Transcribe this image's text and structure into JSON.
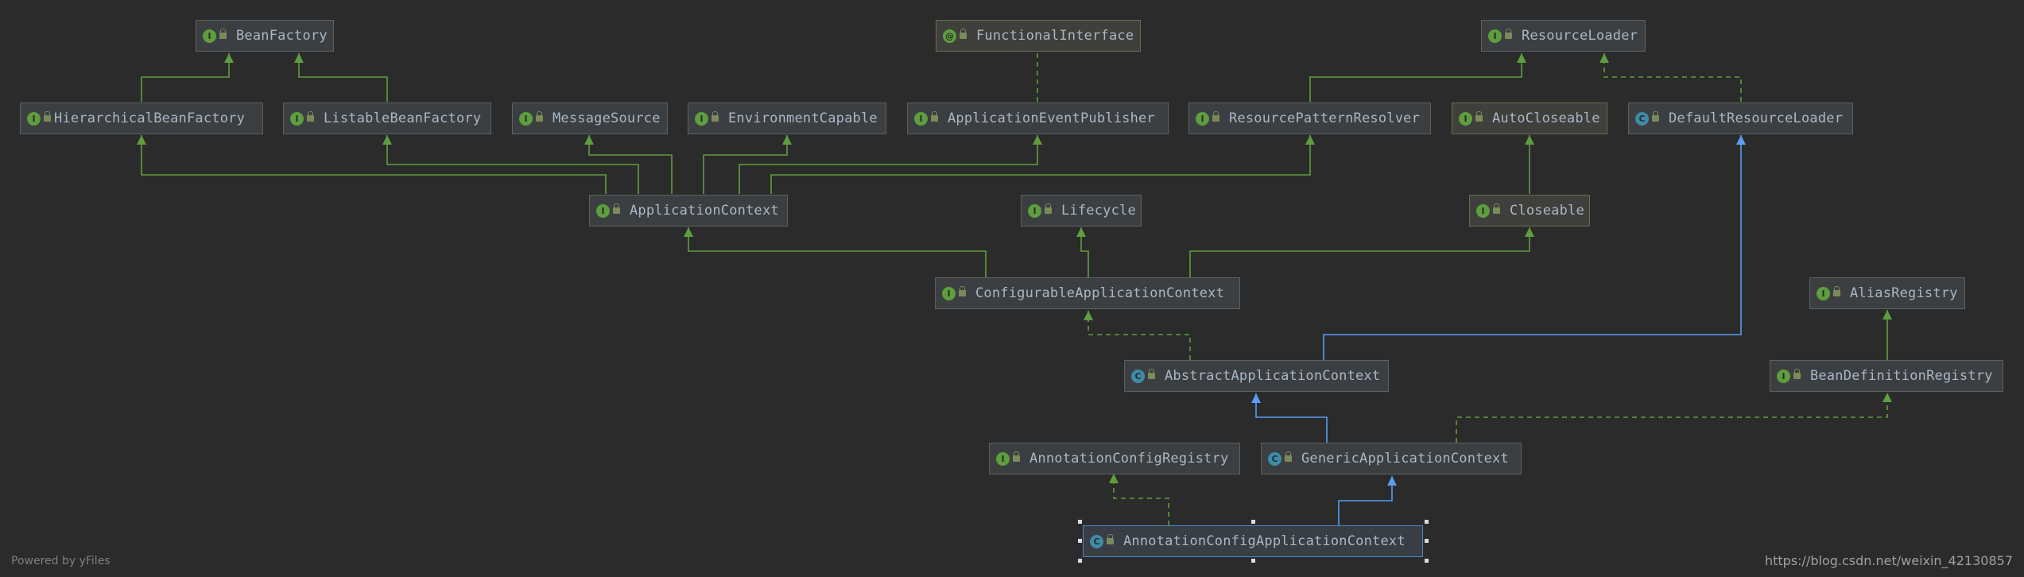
{
  "colors": {
    "background": "#2b2b2b",
    "extends_interface": "#5e9e3e",
    "extends_class": "#589df6",
    "implements": "#5e9e3e"
  },
  "nodes": {
    "bean_factory": {
      "kind": "interface",
      "label": "BeanFactory"
    },
    "functional_interface": {
      "kind": "annotation",
      "label": "FunctionalInterface"
    },
    "resource_loader": {
      "kind": "interface",
      "label": "ResourceLoader"
    },
    "hierarchical_bean_factory": {
      "kind": "interface",
      "label": "HierarchicalBeanFactory"
    },
    "listable_bean_factory": {
      "kind": "interface",
      "label": "ListableBeanFactory"
    },
    "message_source": {
      "kind": "interface",
      "label": "MessageSource"
    },
    "environment_capable": {
      "kind": "interface",
      "label": "EnvironmentCapable"
    },
    "application_event_publisher": {
      "kind": "interface",
      "label": "ApplicationEventPublisher"
    },
    "resource_pattern_resolver": {
      "kind": "interface",
      "label": "ResourcePatternResolver"
    },
    "auto_closeable": {
      "kind": "interface",
      "label": "AutoCloseable"
    },
    "default_resource_loader": {
      "kind": "class",
      "label": "DefaultResourceLoader"
    },
    "application_context": {
      "kind": "interface",
      "label": "ApplicationContext"
    },
    "lifecycle": {
      "kind": "interface",
      "label": "Lifecycle"
    },
    "closeable": {
      "kind": "interface",
      "label": "Closeable"
    },
    "configurable_application_context": {
      "kind": "interface",
      "label": "ConfigurableApplicationContext"
    },
    "alias_registry": {
      "kind": "interface",
      "label": "AliasRegistry"
    },
    "abstract_application_context": {
      "kind": "abstract-class",
      "label": "AbstractApplicationContext"
    },
    "bean_definition_registry": {
      "kind": "interface",
      "label": "BeanDefinitionRegistry"
    },
    "annotation_config_registry": {
      "kind": "interface",
      "label": "AnnotationConfigRegistry"
    },
    "generic_application_context": {
      "kind": "class",
      "label": "GenericApplicationContext"
    },
    "annotation_config_application_context": {
      "kind": "class",
      "label": "AnnotationConfigApplicationContext",
      "selected": true
    }
  },
  "footer": {
    "powered_by": "Powered by yFiles"
  },
  "watermark": "https://blog.csdn.net/weixin_42130857"
}
